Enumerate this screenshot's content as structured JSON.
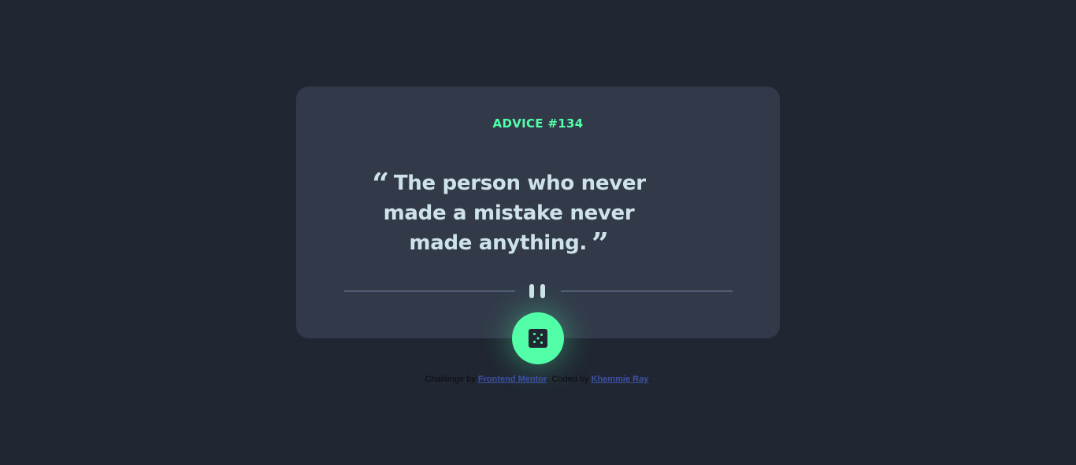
{
  "card": {
    "advice_label": "ADVICE #134",
    "quote_text": "The person who never made a mistake never made anything.",
    "open_quote": "“",
    "close_quote": "”"
  },
  "icons": {
    "divider_icon": "pause-icon",
    "button_icon": "dice-icon"
  },
  "attribution": {
    "challenge_by": "Challenge by",
    "frontend_mentor_link": "Frontend Mentor",
    "separator": ". ",
    "coded_by": "Coded by",
    "author_link": "Khemmie Ray",
    "end": "."
  },
  "colors": {
    "background": "#202632",
    "card": "#323a4a",
    "accent": "#52ffa8",
    "text": "#cee3e9",
    "link": "#3e52a3"
  }
}
